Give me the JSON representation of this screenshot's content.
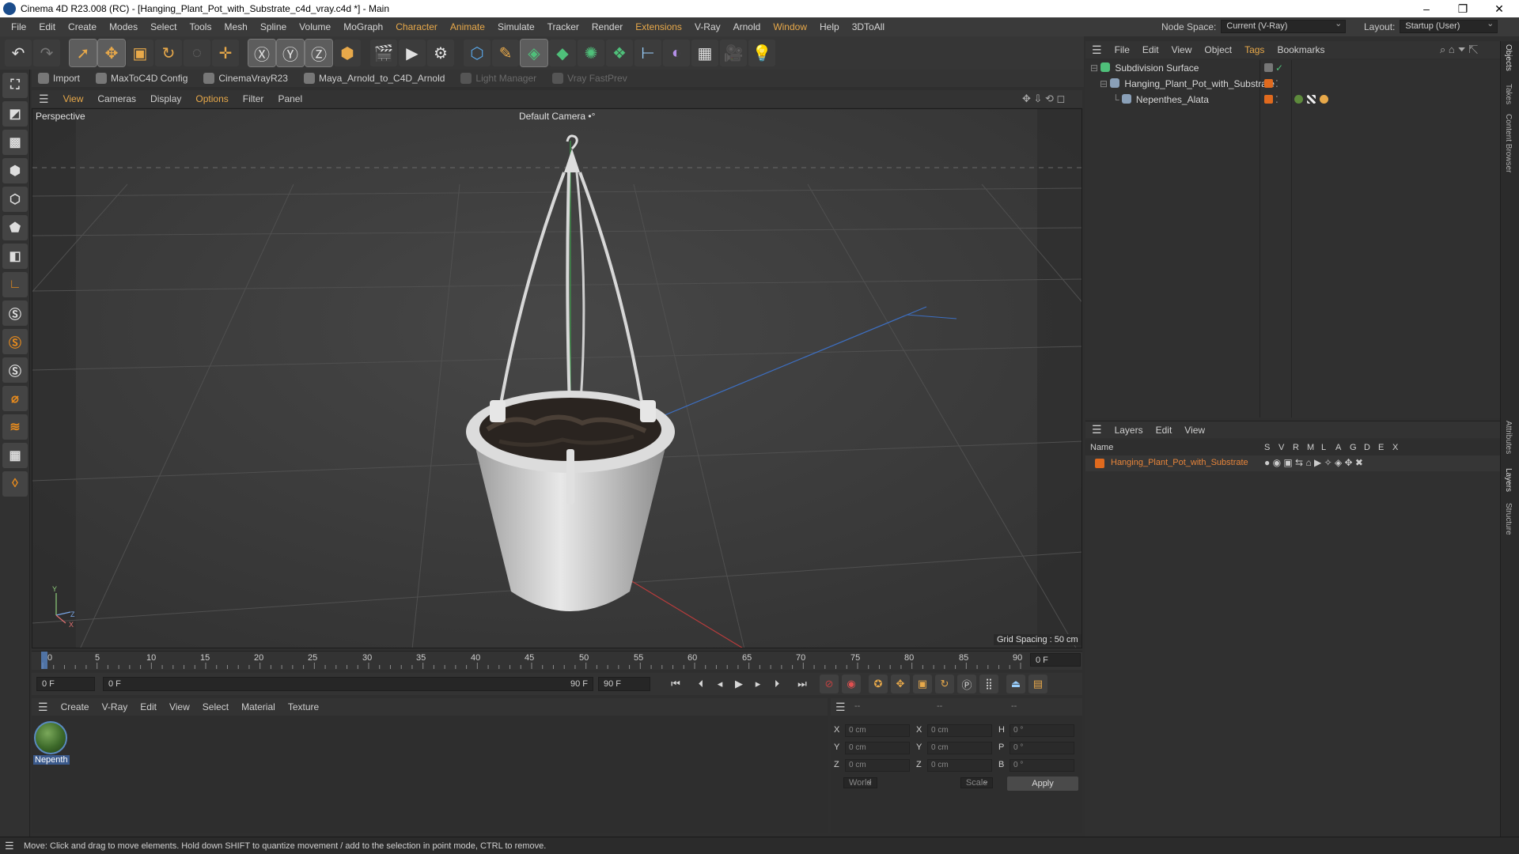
{
  "window": {
    "title": "Cinema 4D R23.008 (RC) - [Hanging_Plant_Pot_with_Substrate_c4d_vray.c4d *] - Main",
    "controls": [
      "–",
      "❐",
      "✕"
    ]
  },
  "menubar": {
    "items": [
      "File",
      "Edit",
      "Create",
      "Modes",
      "Select",
      "Tools",
      "Mesh",
      "Spline",
      "Volume",
      "MoGraph",
      "Character",
      "Animate",
      "Simulate",
      "Tracker",
      "Render",
      "Extensions",
      "V-Ray",
      "Arnold",
      "Window",
      "Help",
      "3DToAll"
    ],
    "node_space_label": "Node Space:",
    "node_space_value": "Current (V-Ray)",
    "layout_label": "Layout:",
    "layout_value": "Startup (User)"
  },
  "plugin_bar": {
    "items": [
      {
        "label": "Import",
        "enabled": true
      },
      {
        "label": "MaxToC4D Config",
        "enabled": true
      },
      {
        "label": "CinemaVrayR23",
        "enabled": true
      },
      {
        "label": "Maya_Arnold_to_C4D_Arnold",
        "enabled": true
      },
      {
        "label": "Light Manager",
        "enabled": false
      },
      {
        "label": "Vray FastPrev",
        "enabled": false
      }
    ]
  },
  "viewport": {
    "menu": [
      "View",
      "Cameras",
      "Display",
      "Options",
      "Filter",
      "Panel"
    ],
    "projection": "Perspective",
    "camera": "Default Camera",
    "camera_suffix": "•°",
    "grid_spacing": "Grid Spacing : 50 cm",
    "axis_labels": {
      "y": "Y",
      "z": "Z",
      "x": "X"
    }
  },
  "timeline": {
    "ticks": [
      "0",
      "5",
      "10",
      "15",
      "20",
      "25",
      "30",
      "35",
      "40",
      "45",
      "50",
      "55",
      "60",
      "65",
      "70",
      "75",
      "80",
      "85",
      "90"
    ],
    "current_frame": "0 F",
    "start_field": "0 F",
    "range_start": "0 F",
    "range_end": "90 F",
    "end_field": "90 F"
  },
  "material_manager": {
    "menu": [
      "Create",
      "V-Ray",
      "Edit",
      "View",
      "Select",
      "Material",
      "Texture"
    ],
    "materials": [
      {
        "name": "Nepenth"
      }
    ]
  },
  "coordinates": {
    "header": [
      "--",
      "--",
      "--"
    ],
    "rows": [
      {
        "a": "X",
        "av": "0 cm",
        "b": "X",
        "bv": "0 cm",
        "c": "H",
        "cv": "0 °"
      },
      {
        "a": "Y",
        "av": "0 cm",
        "b": "Y",
        "bv": "0 cm",
        "c": "P",
        "cv": "0 °"
      },
      {
        "a": "Z",
        "av": "0 cm",
        "b": "Z",
        "bv": "0 cm",
        "c": "B",
        "cv": "0 °"
      }
    ],
    "space": "World",
    "mode": "Scale",
    "apply": "Apply"
  },
  "object_manager": {
    "menu": [
      "File",
      "Edit",
      "View",
      "Object",
      "Tags",
      "Bookmarks"
    ],
    "objects": [
      {
        "name": "Subdivision Surface",
        "depth": 0
      },
      {
        "name": "Hanging_Plant_Pot_with_Substrate",
        "depth": 1
      },
      {
        "name": "Nepenthes_Alata",
        "depth": 2
      }
    ]
  },
  "layer_manager": {
    "menu": [
      "Layers",
      "Edit",
      "View"
    ],
    "columns": [
      "Name",
      "S",
      "V",
      "R",
      "M",
      "L",
      "A",
      "G",
      "D",
      "E",
      "X"
    ],
    "layers": [
      {
        "name": "Hanging_Plant_Pot_with_Substrate",
        "color": "#e06a1e"
      }
    ]
  },
  "right_tabs": [
    "Objects",
    "Takes",
    "Content Browser",
    "Attributes",
    "Layers",
    "Structure"
  ],
  "status": "Move: Click and drag to move elements. Hold down SHIFT to quantize movement / add to the selection in point mode, CTRL to remove.",
  "colors": {
    "accent": "#e8a94a",
    "layer": "#e06a1e",
    "selection": "#3b5a8c"
  }
}
